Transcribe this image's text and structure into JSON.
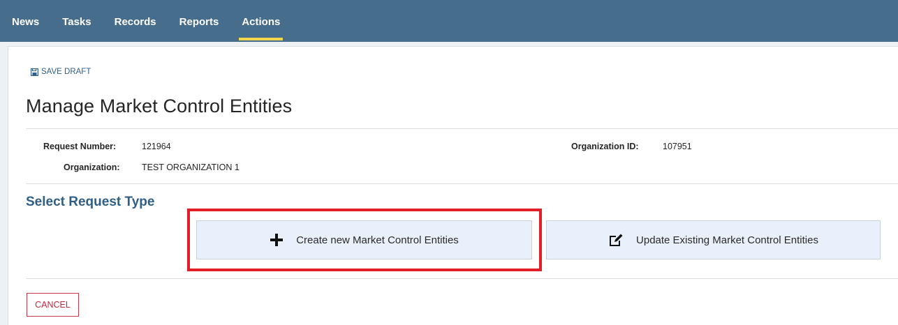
{
  "nav": {
    "items": [
      {
        "label": "News",
        "active": false
      },
      {
        "label": "Tasks",
        "active": false
      },
      {
        "label": "Records",
        "active": false
      },
      {
        "label": "Reports",
        "active": false
      },
      {
        "label": "Actions",
        "active": true
      }
    ]
  },
  "toolbar": {
    "save_draft_label": "SAVE DRAFT",
    "save_icon": "floppy-disk-icon"
  },
  "page": {
    "title": "Manage Market Control Entities"
  },
  "info": {
    "request_number_label": "Request Number:",
    "request_number_value": "121964",
    "organization_id_label": "Organization ID:",
    "organization_id_value": "107951",
    "organization_label": "Organization:",
    "organization_value": "TEST ORGANIZATION 1"
  },
  "request_type": {
    "title": "Select Request Type",
    "create_label": "Create new Market Control Entities",
    "create_icon": "plus-icon",
    "update_label": "Update Existing Market Control Entities",
    "update_icon": "edit-icon"
  },
  "footer": {
    "cancel_label": "CANCEL"
  },
  "colors": {
    "nav_bg": "#466d8c",
    "nav_active_underline": "#f2d54a",
    "accent_blue": "#2f5e86",
    "highlight_red": "#e21f26",
    "cancel_red": "#c0283e",
    "button_bg": "#eaf0fb"
  }
}
